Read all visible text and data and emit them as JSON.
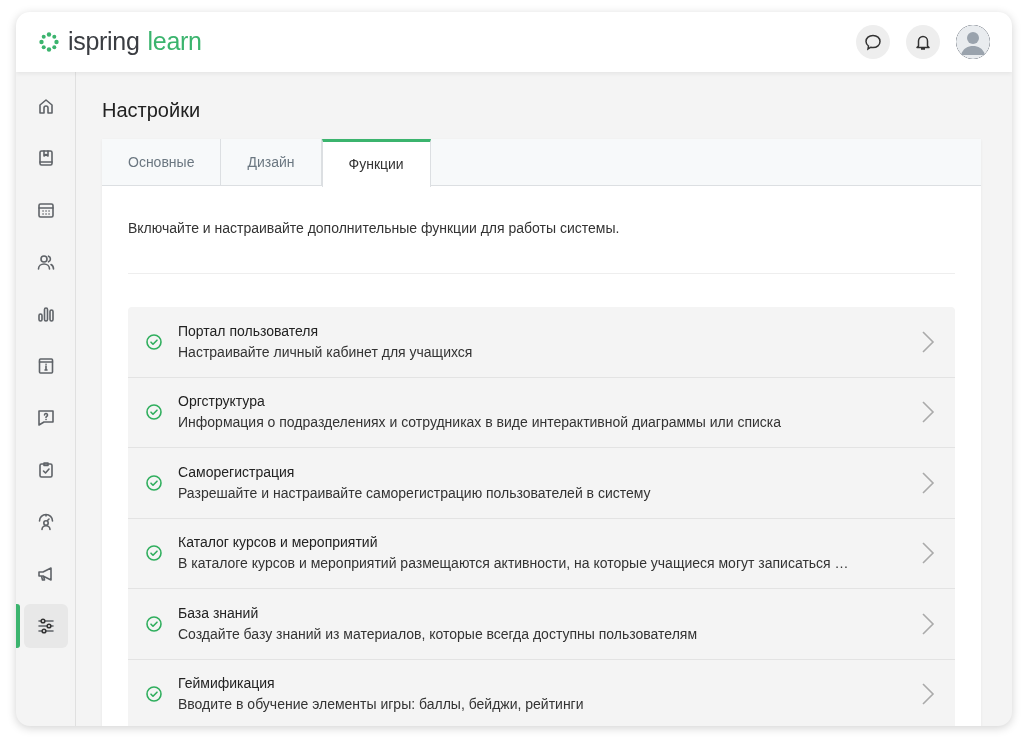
{
  "header": {
    "logo_brand": "ispring",
    "logo_product": "learn"
  },
  "sidebar": {
    "items": [
      {
        "selected": false
      },
      {
        "selected": false
      },
      {
        "selected": false
      },
      {
        "selected": false
      },
      {
        "selected": false
      },
      {
        "selected": false
      },
      {
        "selected": false
      },
      {
        "selected": false
      },
      {
        "selected": false
      },
      {
        "selected": false
      },
      {
        "selected": true
      }
    ]
  },
  "page": {
    "title": "Настройки"
  },
  "tabs": [
    {
      "label": "Основные",
      "selected": false
    },
    {
      "label": "Дизайн",
      "selected": false
    },
    {
      "label": "Функции",
      "selected": true
    }
  ],
  "intro": "Включайте и настраивайте дополнительные функции для работы системы.",
  "features": [
    {
      "title": "Портал пользователя",
      "description": "Настраивайте личный кабинет для учащихся",
      "enabled": true
    },
    {
      "title": "Оргструктура",
      "description": "Информация о подразделениях и сотрудниках в виде интерактивной диаграммы или списка",
      "enabled": true
    },
    {
      "title": "Саморегистрация",
      "description": "Разрешайте и настраивайте саморегистрацию пользователей в систему",
      "enabled": true
    },
    {
      "title": "Каталог курсов и мероприятий",
      "description": "В каталоге курсов и мероприятий размещаются активности, на которые учащиеся могут записаться …",
      "enabled": true
    },
    {
      "title": "База знаний",
      "description": "Создайте базу знаний из материалов, которые всегда доступны пользователям",
      "enabled": true
    },
    {
      "title": "Геймификация",
      "description": "Вводите в обучение элементы игры: баллы, бейджи, рейтинги",
      "enabled": true
    }
  ]
}
